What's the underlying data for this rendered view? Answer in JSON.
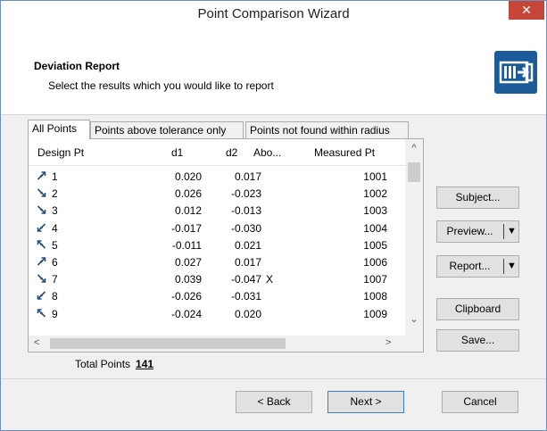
{
  "window": {
    "title": "Point Comparison Wizard",
    "close_glyph": "✕"
  },
  "header": {
    "title": "Deviation Report",
    "subtitle": "Select the results which you would like to report",
    "icon": "report-export-icon"
  },
  "tabs": [
    {
      "label": "All Points",
      "active": true
    },
    {
      "label": "Points above tolerance only",
      "active": false
    },
    {
      "label": "Points not found within radius",
      "active": false
    }
  ],
  "table": {
    "columns": [
      "Design Pt",
      "d1",
      "d2",
      "Abo...",
      "Measured Pt"
    ],
    "rows": [
      {
        "design": "1",
        "d1": "0.020",
        "d2": "0.017",
        "above": "",
        "measured": "1001",
        "icon": "point-up-right-icon"
      },
      {
        "design": "2",
        "d1": "0.026",
        "d2": "-0.023",
        "above": "",
        "measured": "1002",
        "icon": "point-down-right-icon"
      },
      {
        "design": "3",
        "d1": "0.012",
        "d2": "-0.013",
        "above": "",
        "measured": "1003",
        "icon": "point-down-right-icon"
      },
      {
        "design": "4",
        "d1": "-0.017",
        "d2": "-0.030",
        "above": "",
        "measured": "1004",
        "icon": "point-down-left-icon"
      },
      {
        "design": "5",
        "d1": "-0.011",
        "d2": "0.021",
        "above": "",
        "measured": "1005",
        "icon": "point-up-left-icon"
      },
      {
        "design": "6",
        "d1": "0.027",
        "d2": "0.017",
        "above": "",
        "measured": "1006",
        "icon": "point-up-right-icon"
      },
      {
        "design": "7",
        "d1": "0.039",
        "d2": "-0.047",
        "above": "X",
        "measured": "1007",
        "icon": "point-down-right-icon"
      },
      {
        "design": "8",
        "d1": "-0.026",
        "d2": "-0.031",
        "above": "",
        "measured": "1008",
        "icon": "point-down-left-icon"
      },
      {
        "design": "9",
        "d1": "-0.024",
        "d2": "0.020",
        "above": "",
        "measured": "1009",
        "icon": "point-up-left-icon"
      }
    ]
  },
  "scroll": {
    "up": "^",
    "down": "⌄",
    "left": "<",
    "right": ">"
  },
  "total": {
    "label": "Total Points",
    "value": "141"
  },
  "side_buttons": {
    "subject": "Subject...",
    "preview": "Preview...",
    "report": "Report...",
    "clipboard": "Clipboard",
    "save": "Save...",
    "dropdown_glyph": "▼"
  },
  "footer": {
    "back": "< Back",
    "next": "Next >",
    "cancel": "Cancel"
  },
  "colors": {
    "accent": "#1c5b9a",
    "close": "#c7463a",
    "focus": "#3c7fd1"
  }
}
